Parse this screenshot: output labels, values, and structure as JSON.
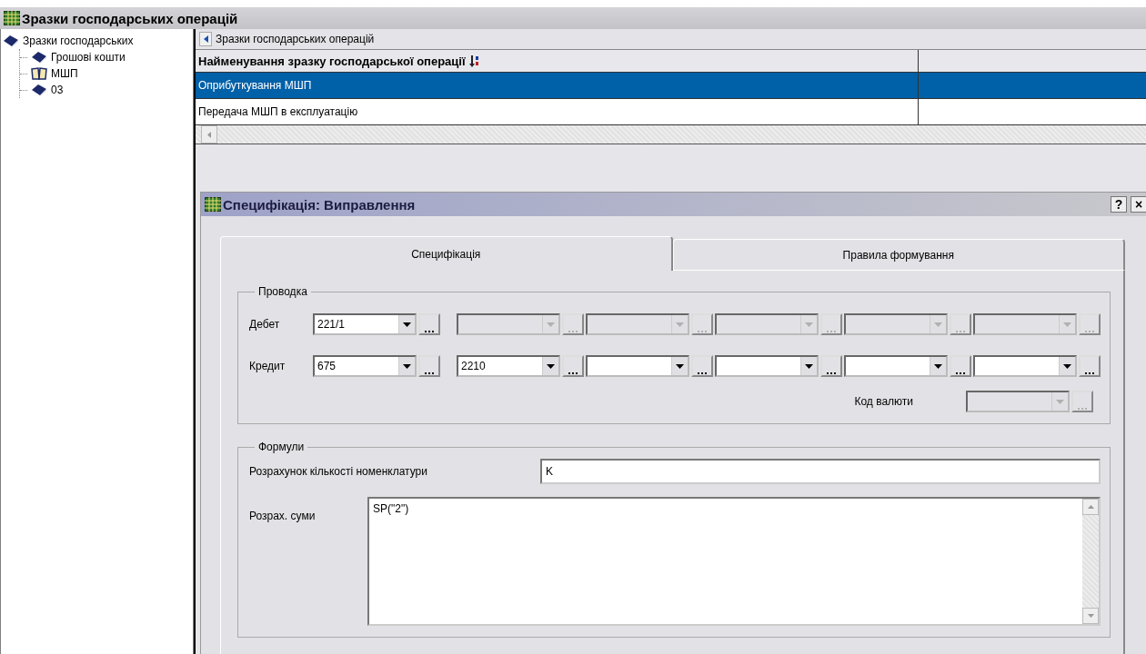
{
  "window": {
    "title": "Зразки господарських операцій"
  },
  "tree": {
    "label": "Зразки господарських",
    "children": [
      {
        "label": "Грошові кошти",
        "open": false
      },
      {
        "label": "МШП",
        "open": true
      },
      {
        "label": "03",
        "open": false
      }
    ]
  },
  "breadcrumb": {
    "label": "Зразки господарських операцій"
  },
  "table": {
    "columns": [
      {
        "label": "Найменування зразку господарської операції",
        "sorted": true
      }
    ],
    "rows": [
      {
        "name": "Оприбуткування МШП",
        "selected": true
      },
      {
        "name": "Передача МШП в експлуатацію",
        "selected": false
      }
    ]
  },
  "dialog": {
    "title": "Специфікація: Виправлення",
    "buttons": [
      "?",
      "×"
    ],
    "tabs": [
      {
        "label": "Специфікація",
        "selected": true
      },
      {
        "label": "Правила формування",
        "selected": false
      }
    ],
    "posting": {
      "title": "Проводка",
      "rows": [
        {
          "label": "Дебет",
          "combos": [
            {
              "value": "221/1",
              "disabled": false
            },
            {
              "disabled": true
            },
            {
              "disabled": true
            },
            {
              "disabled": true
            },
            {
              "disabled": true
            },
            {
              "disabled": true
            }
          ]
        },
        {
          "label": "Кредит",
          "combos": [
            {
              "value": "675",
              "disabled": false
            },
            {
              "value": "2210",
              "disabled": false
            },
            {
              "disabled": false
            },
            {
              "disabled": false
            },
            {
              "disabled": false
            },
            {
              "disabled": false
            }
          ]
        }
      ],
      "currency": {
        "label": "Код валюти",
        "disabled": true
      }
    },
    "formulas": {
      "title": "Формули",
      "quantity": {
        "label": "Розрахунок кількості номенклатури",
        "value": "K"
      },
      "sum": {
        "label": "Розрах. суми",
        "value": "SP(\"2\")"
      }
    }
  }
}
